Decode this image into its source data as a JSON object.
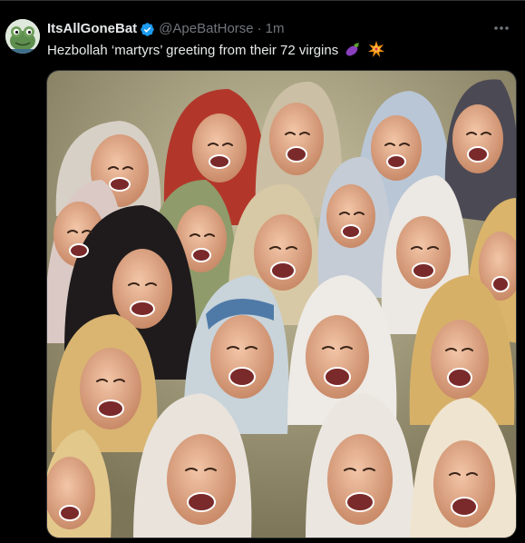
{
  "tweet": {
    "display_name": "ItsAllGoneBat",
    "handle": "@ApeBatHorse",
    "separator": "·",
    "time": "1m",
    "more_label": "···",
    "text": "Hezbollah ‘martyrs’ greeting from their 72 virgins",
    "emojis": [
      "eggplant-emoji",
      "collision-emoji"
    ],
    "avatar_icon": "frog-avatar-icon",
    "media_description_icon": "painting-of-laughing-women"
  },
  "colors": {
    "background": "#000000",
    "text_primary": "#e7e9ea",
    "text_secondary": "#71767b",
    "verified_badge": "#1d9bf0",
    "border": "#2f3336"
  }
}
